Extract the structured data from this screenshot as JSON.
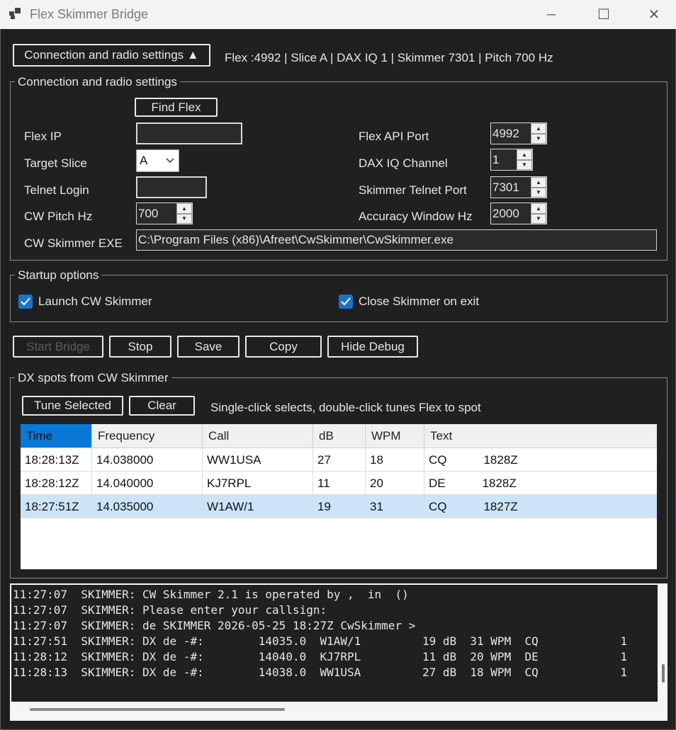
{
  "window": {
    "title": "Flex Skimmer Bridge",
    "controls": {
      "minimize": "─",
      "maximize": "☐",
      "close": "✕"
    }
  },
  "toggle_button": "Connection and radio settings ▲",
  "status_summary": "Flex :4992 | Slice A | DAX IQ 1 | Skimmer 7301 | Pitch 700 Hz",
  "connection": {
    "group_label": "Connection and radio settings",
    "find_flex_label": "Find Flex",
    "flex_ip_label": "Flex IP",
    "flex_ip_value": "",
    "target_slice_label": "Target Slice",
    "target_slice_value": "A",
    "telnet_login_label": "Telnet Login",
    "telnet_login_value": "",
    "cw_pitch_label": "CW Pitch Hz",
    "cw_pitch_value": "700",
    "cw_skimmer_exe_label": "CW Skimmer EXE",
    "cw_skimmer_exe_value": "C:\\Program Files (x86)\\Afreet\\CwSkimmer\\CwSkimmer.exe",
    "flex_api_port_label": "Flex API Port",
    "flex_api_port_value": "4992",
    "dax_iq_label": "DAX IQ Channel",
    "dax_iq_value": "1",
    "skimmer_telnet_port_label": "Skimmer Telnet Port",
    "skimmer_telnet_port_value": "7301",
    "accuracy_window_label": "Accuracy Window Hz",
    "accuracy_window_value": "2000"
  },
  "startup": {
    "group_label": "Startup options",
    "launch_label": "Launch CW Skimmer",
    "launch_checked": true,
    "close_label": "Close Skimmer on exit",
    "close_checked": true
  },
  "actions": {
    "start": "Start Bridge",
    "stop": "Stop",
    "save": "Save",
    "copy": "Copy",
    "hide_debug": "Hide Debug"
  },
  "spots": {
    "group_label": "DX spots from CW Skimmer",
    "tune_selected": "Tune Selected",
    "clear": "Clear",
    "hint": "Single-click selects, double-click tunes Flex to spot",
    "columns": [
      "Time",
      "Frequency",
      "Call",
      "dB",
      "WPM",
      "Text"
    ],
    "rows": [
      [
        "18:28:13Z",
        "14.038000",
        "WW1USA",
        "27",
        "18",
        "CQ           1828Z"
      ],
      [
        "18:28:12Z",
        "14.040000",
        "KJ7RPL",
        "11",
        "20",
        "DE           1828Z"
      ],
      [
        "18:27:51Z",
        "14.035000",
        "W1AW/1",
        "19",
        "31",
        "CQ           1827Z"
      ]
    ],
    "selected_row": 2
  },
  "log": {
    "lines": [
      "11:27:07  SKIMMER: CW Skimmer 2.1 is operated by ,  in  ()",
      "11:27:07  SKIMMER: Please enter your callsign:",
      "11:27:07  SKIMMER: de SKIMMER 2026-05-25 18:27Z CwSkimmer >",
      "11:27:51  SKIMMER: DX de -#:        14035.0  W1AW/1         19 dB  31 WPM  CQ            1",
      "11:28:12  SKIMMER: DX de -#:        14040.0  KJ7RPL         11 dB  20 WPM  DE            1",
      "11:28:13  SKIMMER: DX de -#:        14038.0  WW1USA         27 dB  18 WPM  CQ            1"
    ]
  }
}
